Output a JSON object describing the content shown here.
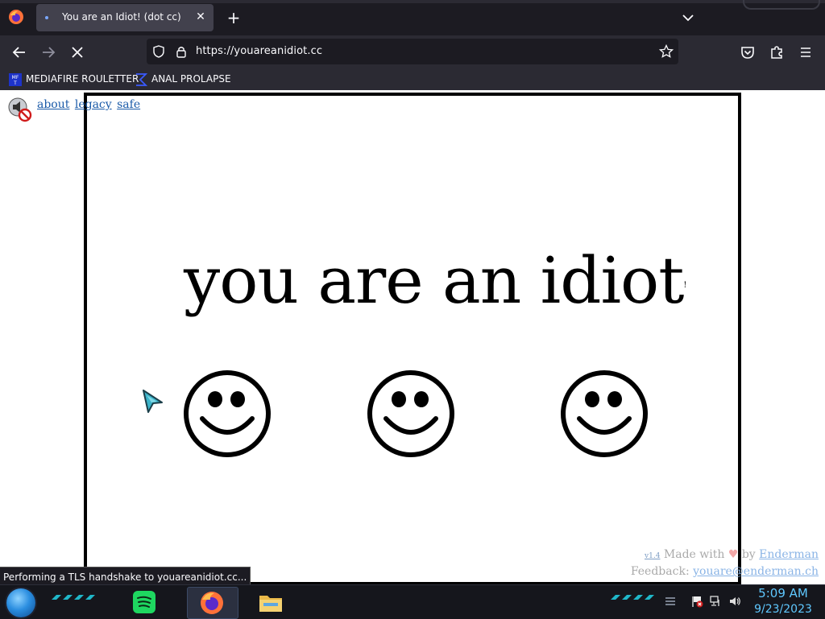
{
  "browser": {
    "tab": {
      "title": "You are an Idiot! (dot cc)"
    },
    "url": "https://youareanidiot.cc",
    "bookmarks": [
      {
        "label": "MEDIAFIRE ROULETTER",
        "icon": "mediafire-icon"
      },
      {
        "label": "ANAL PROLAPSE",
        "icon": "sigma-icon"
      }
    ]
  },
  "page": {
    "links": [
      "about",
      "legacy",
      "safe"
    ],
    "headline": "you are an idiot",
    "headline_mark": "!",
    "credits": {
      "version": "v1.4",
      "made_with": "Made with",
      "by": "by",
      "author": "Enderman",
      "feedback_label": "Feedback:",
      "email": "youare@enderman.ch"
    }
  },
  "status": "Performing a TLS handshake to youareanidiot.cc...",
  "taskbar": {
    "time": "5:09 AM",
    "date": "9/23/2023"
  },
  "colors": {
    "chrome_dark": "#1c1b22",
    "chrome": "#2b2a33",
    "tab_active": "#42414d",
    "link": "#1a5aa8",
    "clock": "#5fc8ff"
  }
}
